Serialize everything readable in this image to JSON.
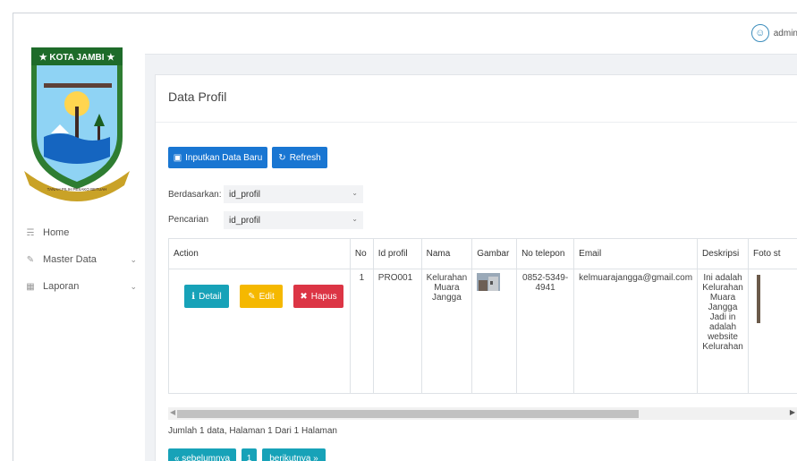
{
  "brand": {
    "logo_text": "★ KOTA JAMBI ★",
    "ribbon_text": "TANAH PILIH PESAKO BETUAH"
  },
  "nav": {
    "home": "Home",
    "master": "Master Data",
    "laporan": "Laporan"
  },
  "topbar": {
    "user_name": "admin"
  },
  "page": {
    "title": "Data Profil",
    "add_button": "Inputkan Data Baru",
    "refresh_button": "Refresh",
    "filter_label": "Berdasarkan:",
    "filter_value": "id_profil",
    "search_label": "Pencarian",
    "search_value": "id_profil"
  },
  "table": {
    "headers": {
      "action": "Action",
      "no": "No",
      "id": "Id profil",
      "nama": "Nama",
      "gambar": "Gambar",
      "telp": "No telepon",
      "email": "Email",
      "deskripsi": "Deskripsi",
      "foto": "Foto st"
    },
    "row": {
      "detail_button": "Detail",
      "edit_button": "Edit",
      "hapus_button": "Hapus",
      "no": "1",
      "id": "PRO001",
      "nama": "Kelurahan Muara Jangga",
      "telp": "0852-5349-4941",
      "email": "kelmuarajangga@gmail.com",
      "deskripsi": "Ini adalah Kelurahan Muara Jangga Jadi in adalah website Kelurahan"
    }
  },
  "footer": {
    "info": "Jumlah 1 data, Halaman 1 Dari 1 Halaman",
    "prev": "« sebelumnya",
    "page": "1",
    "next": "berikutnya »"
  },
  "colors": {
    "primary": "#1976d2",
    "info": "#17a2b8",
    "warning": "#f5b800",
    "danger": "#dc3545"
  }
}
